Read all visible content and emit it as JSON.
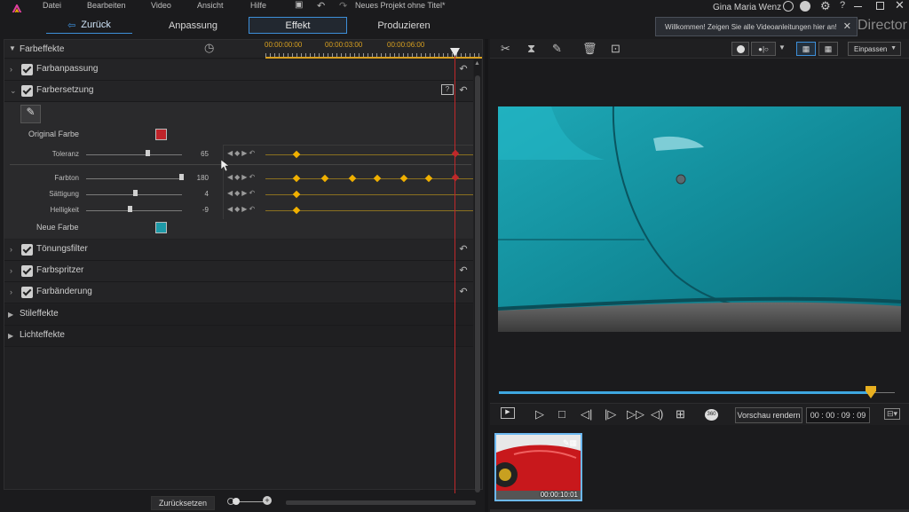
{
  "menu": {
    "items": [
      "Datei",
      "Bearbeiten",
      "Video",
      "Ansicht",
      "Hilfe"
    ],
    "project_title": "Neues Projekt ohne Titel*",
    "user": "Gina Maria Wenz"
  },
  "tabs": {
    "back": "Zurück",
    "adjust": "Anpassung",
    "effect": "Effekt",
    "produce": "Produzieren"
  },
  "notification": {
    "text": "Willkommen! Zeigen Sie alle Videoanleitungen hier an!",
    "app_name": "Director"
  },
  "left": {
    "section": "Farbeffekte",
    "ruler": [
      "00:00:00:00",
      "00:00:03:00",
      "00:00:06:00"
    ],
    "rows": {
      "adjust": "Farbanpassung",
      "replace": "Farbersetzung",
      "tint": "Tönungsfilter",
      "splash": "Farbspritzer",
      "change": "Farbänderung"
    },
    "groups": {
      "style": "Stileffekte",
      "light": "Lichteffekte"
    },
    "original_color_label": "Original Farbe",
    "new_color_label": "Neue Farbe",
    "params": [
      {
        "label": "Toleranz",
        "value": "65",
        "level": 0.65
      },
      {
        "label": "Farbton",
        "value": "180",
        "level": 1.0
      },
      {
        "label": "Sättigung",
        "value": "4",
        "level": 0.52
      },
      {
        "label": "Helligkeit",
        "value": "-9",
        "level": 0.46
      }
    ],
    "reset_button": "Zurücksetzen"
  },
  "right": {
    "fit_select": "Einpassen",
    "render_button": "Vorschau rendern",
    "timecode": "00 : 00 : 09 : 09",
    "clip_duration": "00:00:10:01",
    "playback_progress": 0.94
  },
  "colors": {
    "accent": "#3d8fd9",
    "original_color": "#c0242a",
    "new_color": "#1e9aa8",
    "keyframe": "#f0b000",
    "playhead": "#c0282a"
  }
}
